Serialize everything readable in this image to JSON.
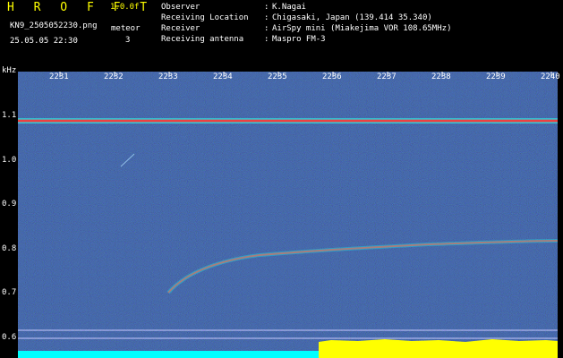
{
  "header": {
    "app_name": "H R O F F T",
    "version": "1.0.0f",
    "filename": "KN9_2505052230.png",
    "datetime": "25.05.05 22:30",
    "meteor_label": "meteor",
    "meteor_count": "3"
  },
  "info": [
    {
      "key": "Observer",
      "value": "K.Nagai"
    },
    {
      "key": "Receiving Location",
      "value": "Chigasaki, Japan (139.414 35.340)"
    },
    {
      "key": "Receiver",
      "value": "AirSpy mini (Miakejima VOR 108.65MHz)"
    },
    {
      "key": "Receiving antenna",
      "value": "Maspro FM-3"
    }
  ],
  "axis": {
    "y_unit": "kHz",
    "y_ticks": [
      "1.1",
      "1.0",
      "0.9",
      "0.8",
      "0.7",
      "0.6"
    ],
    "x_ticks": [
      "2231",
      "2232",
      "2233",
      "2234",
      "2235",
      "2236",
      "2237",
      "2238",
      "2239",
      "2240"
    ]
  },
  "colors": {
    "background": "#000000",
    "plot_bg": "#0a0a66",
    "label": "#ffffff",
    "brand": "#ffff00",
    "bottom_left_bar": "#00ffff",
    "bottom_right_bar": "#ffff00"
  }
}
